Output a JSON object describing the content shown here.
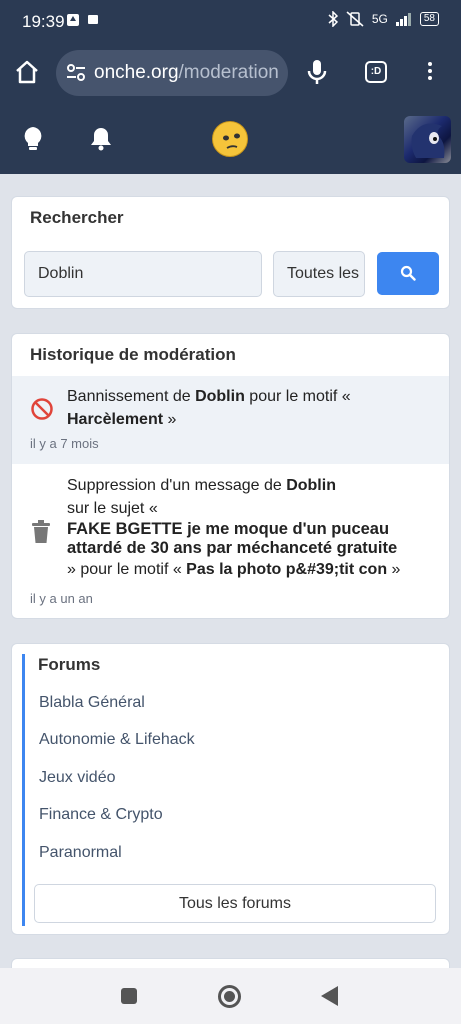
{
  "status_bar": {
    "time": "19:39",
    "network": "5G",
    "battery": "58"
  },
  "browser": {
    "url_host": "onche.org",
    "url_path": "/moderation",
    "tabs_label": ":D"
  },
  "search": {
    "title": "Rechercher",
    "query_value": "Doblin",
    "scope_value": "Toutes les"
  },
  "moderation": {
    "title": "Historique de modération",
    "items": [
      {
        "prefix": "Bannissement de ",
        "user": "Doblin",
        "mid": " pour le motif « ",
        "reason": "Harcèlement",
        "suffix": " »",
        "time": "il y a 7 mois"
      },
      {
        "prefix": "Suppression d'un message de ",
        "user": "Doblin",
        "subject_intro": "sur le sujet « ",
        "subject": "FAKE BGETTE je me moque d'un puceau attardé de 30 ans par méchanceté gratuite",
        "mid": " » pour le motif « ",
        "reason": "Pas la photo p&#39;tit con",
        "suffix": " »",
        "time": "il y a un an"
      }
    ]
  },
  "forums": {
    "title": "Forums",
    "links": [
      "Blabla Général",
      "Autonomie & Lifehack",
      "Jeux vidéo",
      "Finance & Crypto",
      "Paranormal"
    ],
    "all_label": "Tous les forums"
  },
  "colors": {
    "header_bg": "#2b3a53",
    "accent": "#3d86f0",
    "ban_red": "#e0443a",
    "page_bg": "#dfe3ea"
  }
}
